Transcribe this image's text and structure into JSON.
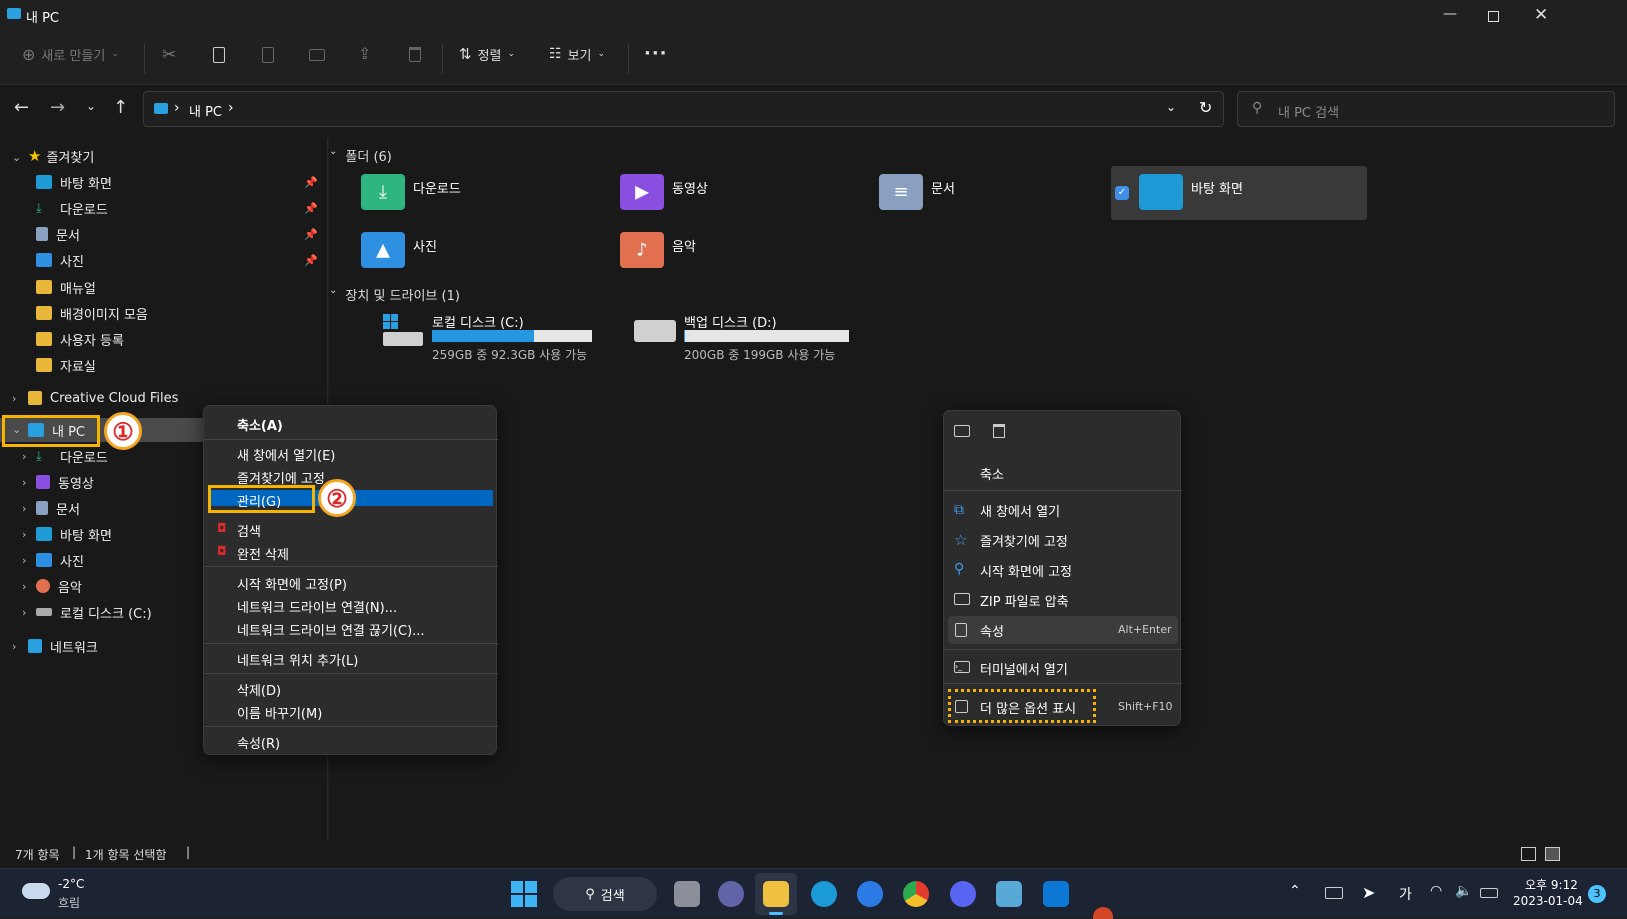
{
  "window": {
    "title": "내 PC"
  },
  "toolbar": {
    "new_label": "새로 만들기",
    "sort_label": "정렬",
    "view_label": "보기",
    "more": "···"
  },
  "address": {
    "crumb": "내 PC",
    "sep1": "›",
    "sep2": "›",
    "search_placeholder": "내 PC 검색"
  },
  "sidebar": {
    "favorites": "즐겨찾기",
    "fav_items": [
      "바탕 화면",
      "다운로드",
      "문서",
      "사진",
      "매뉴얼",
      "배경이미지 모음",
      "사용자 등록",
      "자료실"
    ],
    "creative": "Creative Cloud Files",
    "mypc": "내 PC",
    "pc_items": [
      "다운로드",
      "동영상",
      "문서",
      "바탕 화면",
      "사진",
      "음악",
      "로컬 디스크 (C:)"
    ],
    "network": "네트워크"
  },
  "main": {
    "folders_header": "폴더 (6)",
    "folders": [
      "다운로드",
      "동영상",
      "문서",
      "바탕 화면",
      "사진",
      "음악"
    ],
    "drives_header": "장치 및 드라이브 (1)",
    "drives": [
      {
        "name": "로컬 디스크 (C:)",
        "info": "259GB 중 92.3GB 사용 가능",
        "fill": 0.64
      },
      {
        "name": "백업 디스크 (D:)",
        "info": "200GB 중 199GB 사용 가능",
        "fill": 0.005
      }
    ]
  },
  "context_menu": {
    "items": [
      "축소(A)",
      "새 창에서 열기(E)",
      "즐겨찾기에 고정",
      "관리(G)",
      "검색",
      "완전 삭제",
      "시작 화면에 고정(P)",
      "네트워크 드라이브 연결(N)...",
      "네트워크 드라이브 연결 끊기(C)...",
      "네트워크 위치 추가(L)",
      "삭제(D)",
      "이름 바꾸기(M)",
      "속성(R)"
    ]
  },
  "context_menu2": {
    "collapse": "축소",
    "items": [
      "새 창에서 열기",
      "즐겨찾기에 고정",
      "시작 화면에 고정",
      "ZIP 파일로 압축",
      "속성",
      "터미널에서 열기",
      "더 많은 옵션 표시"
    ],
    "prop_shortcut": "Alt+Enter",
    "more_shortcut": "Shift+F10"
  },
  "badges": {
    "one": "①",
    "two": "②"
  },
  "status": {
    "count": "7개 항목",
    "selected": "1개 항목 선택함",
    "sep": "|"
  },
  "taskbar": {
    "temp": "-2°C",
    "weather": "흐림",
    "search": "검색",
    "time": "오후 9:12",
    "date": "2023-01-04",
    "ime": "가",
    "notif": "3"
  },
  "colors": {
    "accent": "#0067c0",
    "highlight": "#f5b400",
    "dark": "#191919"
  }
}
